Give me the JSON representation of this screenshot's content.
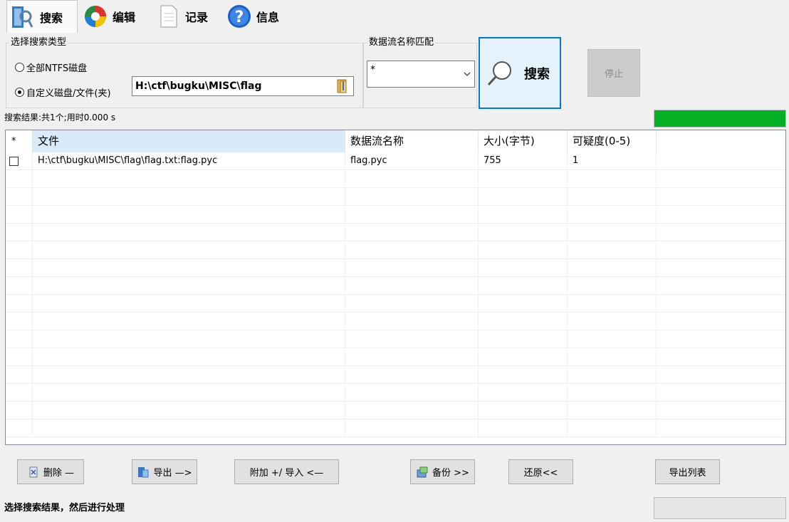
{
  "tabs": [
    {
      "label": "搜索",
      "icon": "search-tab-icon",
      "active": true
    },
    {
      "label": "编辑",
      "icon": "edit-tab-icon",
      "active": false
    },
    {
      "label": "记录",
      "icon": "record-tab-icon",
      "active": false
    },
    {
      "label": "信息",
      "icon": "info-tab-icon",
      "active": false
    }
  ],
  "search_type": {
    "title": "选择搜索类型",
    "option_all": "全部NTFS磁盘",
    "option_custom": "自定义磁盘/文件(夹)",
    "selected": "custom",
    "path_value": "H:\\ctf\\bugku\\MISC\\flag"
  },
  "stream_match": {
    "title": "数据流名称匹配",
    "value": "*"
  },
  "actions": {
    "search_label": "搜索",
    "stop_label": "停止"
  },
  "result_summary": "搜索结果:共1个;用时0.000 s",
  "progress_percent": 100,
  "table": {
    "columns": [
      "*",
      "文件",
      "数据流名称",
      "大小(字节)",
      "可疑度(0-5)"
    ],
    "rows": [
      {
        "checked": false,
        "file": "H:\\ctf\\bugku\\MISC\\flag\\flag.txt:flag.pyc",
        "stream": "flag.pyc",
        "size": "755",
        "suspicion": "1"
      }
    ]
  },
  "buttons": {
    "delete": "删除 —",
    "export": "导出 —>",
    "attach_import": "附加 +/ 导入 <—",
    "backup": "备份 >>",
    "restore": "还原<<",
    "export_list": "导出列表"
  },
  "status_text": "选择搜索结果，然后进行处理",
  "colors": {
    "accent": "#0078d7",
    "progress": "#06b025",
    "header_sorted": "#d9ebf9"
  }
}
